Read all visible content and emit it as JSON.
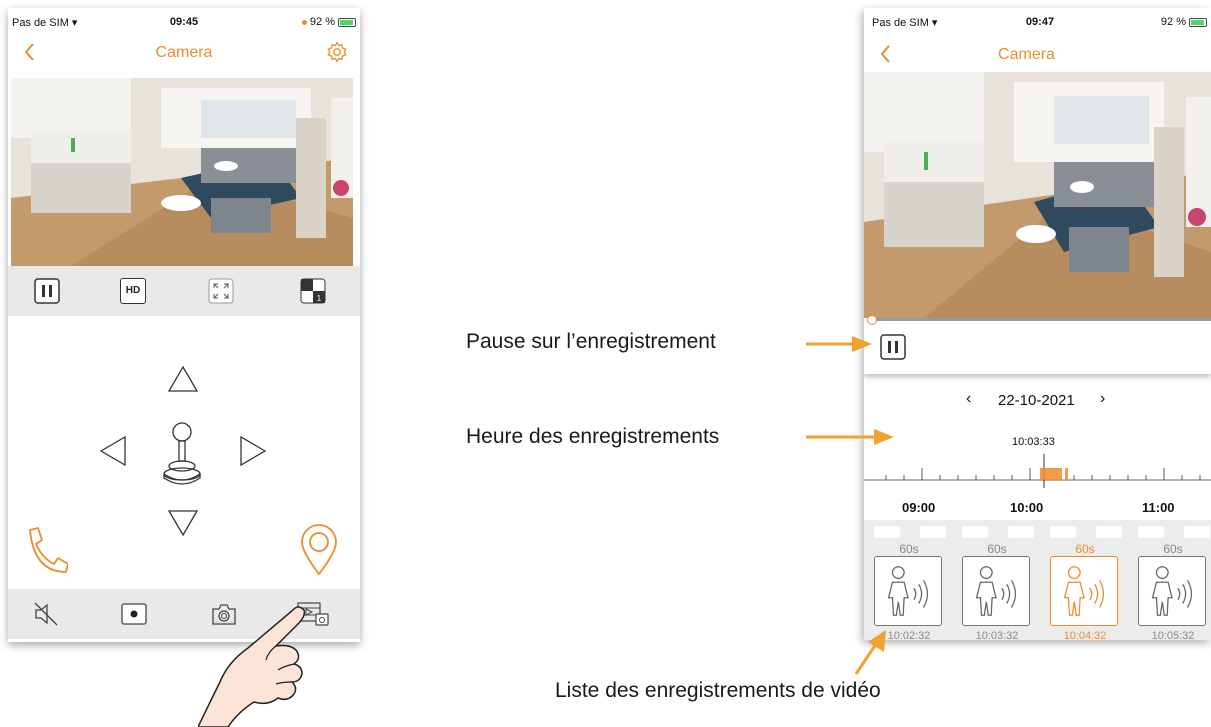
{
  "phone1": {
    "status": {
      "carrier": "Pas de SIM",
      "time": "09:45",
      "battery": "92 %"
    },
    "title": "Camera",
    "icons": {
      "back": "chevron-left-icon",
      "settings": "gear-icon",
      "controls": [
        "pause-icon",
        "hd-icon",
        "fullscreen-icon",
        "split-view-icon"
      ],
      "ptz": [
        "arrow-up-icon",
        "arrow-left-icon",
        "joystick-icon",
        "arrow-right-icon",
        "arrow-down-icon"
      ],
      "call": "phone-icon",
      "location": "location-pin-icon",
      "bottom": [
        "mute-icon",
        "record-icon",
        "camera-icon",
        "playback-icon"
      ]
    },
    "hd_label": "HD",
    "split_badge": "1"
  },
  "phone2": {
    "status": {
      "carrier": "Pas de SIM",
      "time": "09:47",
      "battery": "92 %"
    },
    "title": "Camera",
    "date": "22-10-2021",
    "date_prev": "‹",
    "date_next": "›",
    "current_time": "10:03:33",
    "timeline_labels": [
      "09:00",
      "10:00",
      "11:00"
    ],
    "recordings": [
      {
        "duration": "60s",
        "time": "10:02:32",
        "active": false
      },
      {
        "duration": "60s",
        "time": "10:03:32",
        "active": false
      },
      {
        "duration": "60s",
        "time": "10:04:32",
        "active": true
      },
      {
        "duration": "60s",
        "time": "10:05:32",
        "active": false
      }
    ]
  },
  "annotations": {
    "pause": "Pause sur l’enregistrement",
    "hours": "Heure des enregistrements",
    "list": "Liste des enregistrements de vidéo"
  },
  "colors": {
    "accent": "#ef8a2c",
    "bar": "#e9e9ea",
    "arrow": "#f0a22e"
  }
}
